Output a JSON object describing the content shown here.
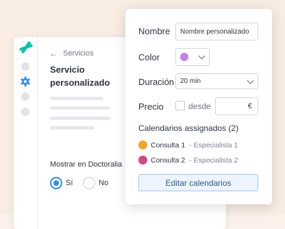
{
  "colors": {
    "background": "#fbf1ea",
    "brand": "#00c3a5",
    "accent": "#2f8cf0",
    "color_swatch": "#c780e8",
    "calendar_1": "#f5a623",
    "calendar_2": "#d6478a"
  },
  "back_panel": {
    "breadcrumb": "Servicios",
    "title": "Servicio personalizado",
    "show_label": "Mostrar en Doctoralia",
    "radio_yes": "Sí",
    "radio_no": "No",
    "radio_selected": "yes"
  },
  "form": {
    "name_label": "Nombre",
    "name_value": "Nombre personalizado",
    "color_label": "Color",
    "duration_label": "Duración",
    "duration_value": "20 min",
    "price_label": "Precio",
    "desde_label": "desde",
    "currency": "€",
    "calendars_title": "Calendarios assignados (2)",
    "calendars": [
      {
        "name": "Consulta 1",
        "specialist": "- Especialista 1",
        "color": "#f5a623"
      },
      {
        "name": "Consulta 2",
        "specialist": "- Especialista 2",
        "color": "#d6478a"
      }
    ],
    "edit_button": "Editar calendarios"
  }
}
